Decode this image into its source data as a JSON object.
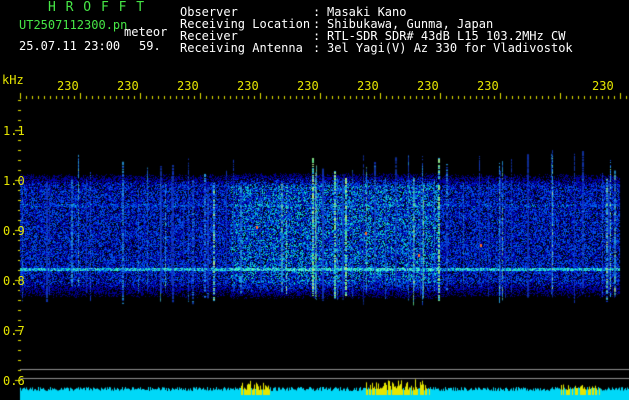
{
  "header": {
    "title": "H R O F F T",
    "file_name": "UT2507112300.pn",
    "file_suffix": "meteor",
    "date_time": "25.07.11 23:00",
    "seconds": "59.",
    "fields": [
      {
        "label": "Observer",
        "value": "Masaki Kano"
      },
      {
        "label": "Receiving Location",
        "value": "Shibukawa, Gunma, Japan"
      },
      {
        "label": "Receiver",
        "value": "RTL-SDR SDR# 43dB L15 103.2MHz CW"
      },
      {
        "label": "Receiving Antenna",
        "value": "3el Yagi(V) Az 330 for Vladivostok"
      }
    ],
    "separator": ":"
  },
  "axis": {
    "unit": "kHz",
    "y_ticks": [
      "1.1",
      "1.0",
      "0.9",
      "0.8",
      "0.7",
      "0.6"
    ],
    "time_ticks": [
      "230",
      "230",
      "230",
      "230",
      "230",
      "230",
      "230",
      "230",
      "230",
      "2310"
    ]
  },
  "colors": {
    "background": "#000000",
    "title_green": "#46e646",
    "label_yellow": "#e6e600",
    "text_white": "#ffffff",
    "baseline_cyan": "#00d8f8"
  }
}
